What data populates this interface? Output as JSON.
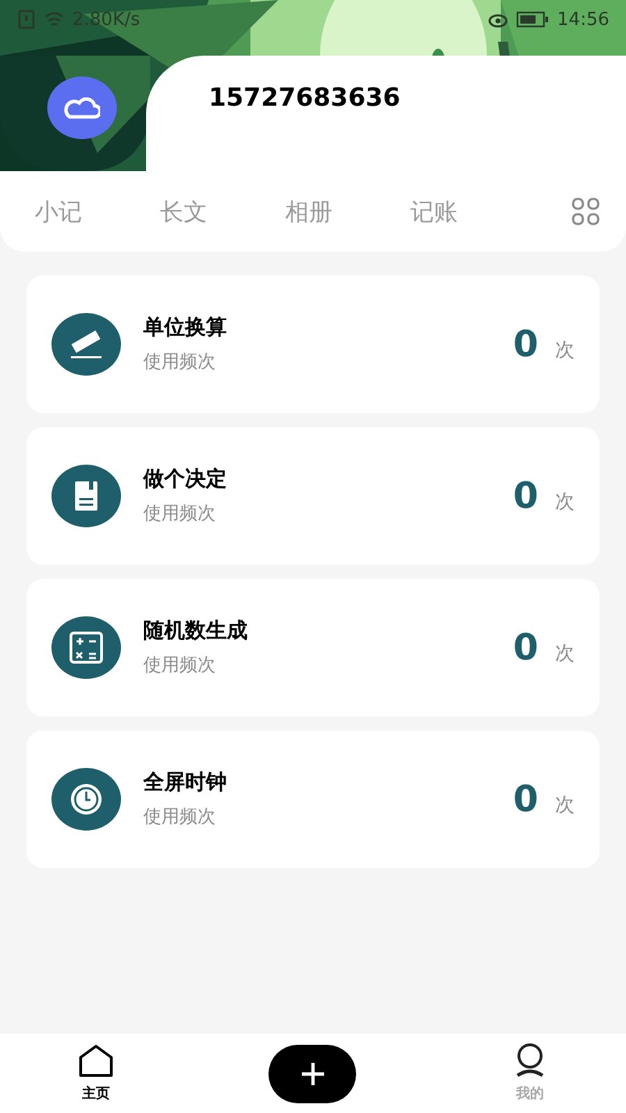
{
  "status_bar": {
    "speed": "2.80K/s",
    "time": "14:56"
  },
  "profile": {
    "phone": "15727683636"
  },
  "tabs": [
    {
      "label": "小记"
    },
    {
      "label": "长文"
    },
    {
      "label": "相册"
    },
    {
      "label": "记账"
    }
  ],
  "tools": [
    {
      "kind": "ruler",
      "title": "单位换算",
      "subtitle": "使用频次",
      "count": "0",
      "unit": "次"
    },
    {
      "kind": "book",
      "title": "做个决定",
      "subtitle": "使用频次",
      "count": "0",
      "unit": "次"
    },
    {
      "kind": "calculator",
      "title": "随机数生成",
      "subtitle": "使用频次",
      "count": "0",
      "unit": "次"
    },
    {
      "kind": "clock",
      "title": "全屏时钟",
      "subtitle": "使用频次",
      "count": "0",
      "unit": "次"
    }
  ],
  "bottom_nav": [
    {
      "kind": "home",
      "label": "主页",
      "selected": true
    },
    {
      "kind": "add"
    },
    {
      "kind": "user",
      "label": "我的",
      "selected": false
    }
  ]
}
